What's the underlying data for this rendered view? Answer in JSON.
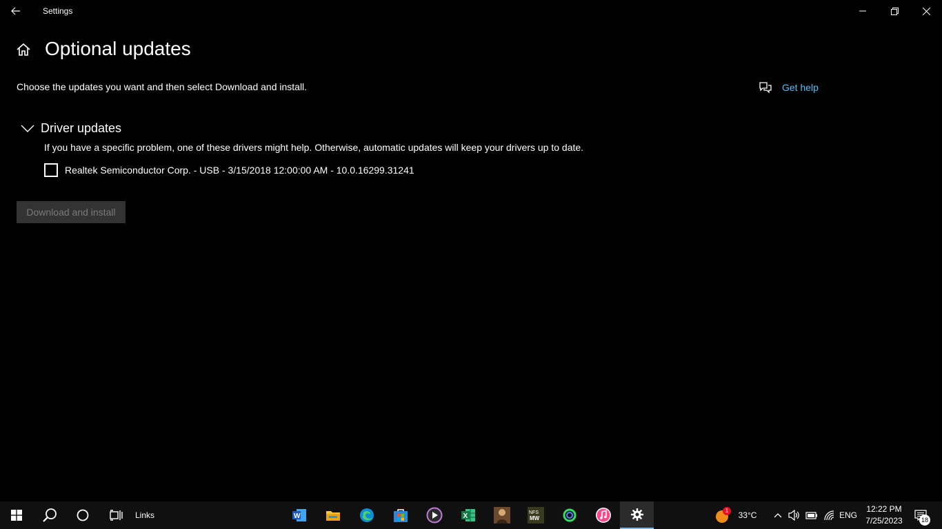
{
  "window": {
    "title": "Settings"
  },
  "page": {
    "title": "Optional updates",
    "intro": "Choose the updates you want and then select Download and install.",
    "get_help": "Get help"
  },
  "driver_updates": {
    "title": "Driver updates",
    "description": "If you have a specific problem, one of these drivers might help. Otherwise, automatic updates will keep your drivers up to date.",
    "items": [
      {
        "label": "Realtek Semiconductor Corp. - USB - 3/15/2018 12:00:00 AM - 10.0.16299.31241",
        "checked": false
      }
    ]
  },
  "actions": {
    "download_install": "Download and install"
  },
  "taskbar": {
    "links_label": "Links",
    "pinned_apps": [
      "word-icon",
      "file-explorer-icon",
      "edge-icon",
      "store-icon",
      "media-player-icon",
      "excel-icon",
      "game-icon",
      "mw-game-icon",
      "app-icon",
      "itunes-icon",
      "settings-icon"
    ],
    "weather_temp": "33°C",
    "weather_badge": "1",
    "language": "ENG",
    "time": "12:22 PM",
    "date": "7/25/2023",
    "notifications": "18"
  },
  "colors": {
    "background": "#000000",
    "accent_link": "#4cc2ff",
    "taskbar": "#101010"
  }
}
